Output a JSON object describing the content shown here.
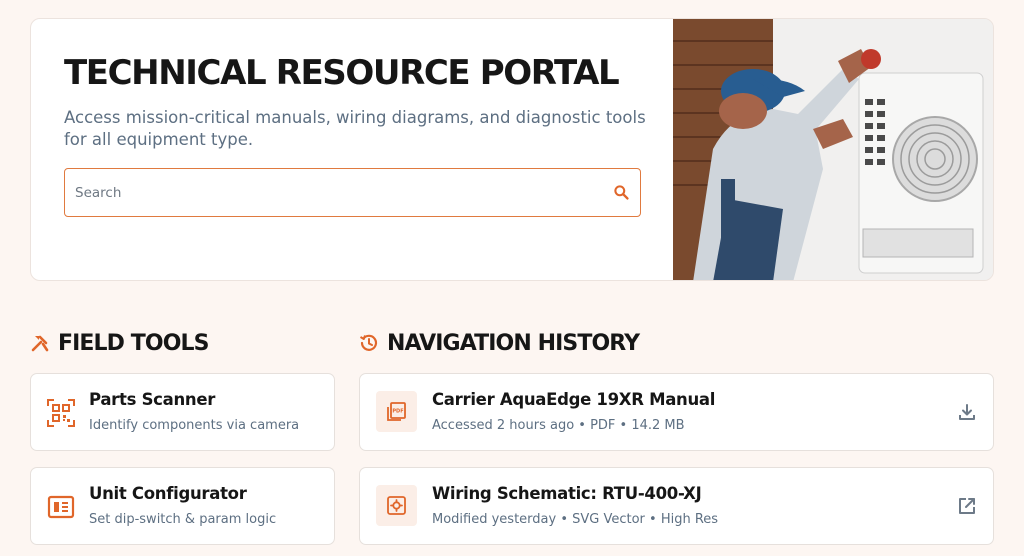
{
  "hero": {
    "title": "TECHNICAL RESOURCE PORTAL",
    "subtitle": "Access mission-critical manuals, wiring diagrams, and diagnostic tools for all equipment type.",
    "search_placeholder": "Search"
  },
  "field_tools": {
    "title": "FIELD TOOLS",
    "items": [
      {
        "title": "Parts Scanner",
        "subtitle": "Identify components via camera",
        "icon": "qr-scan-icon"
      },
      {
        "title": "Unit Configurator",
        "subtitle": "Set dip-switch & param logic",
        "icon": "chip-icon"
      }
    ]
  },
  "navigation_history": {
    "title": "NAVIGATION HISTORY",
    "items": [
      {
        "title": "Carrier AquaEdge 19XR Manual",
        "meta": "Accessed 2 hours ago • PDF • 14.2 MB",
        "icon": "pdf-file-icon",
        "action": "download-icon"
      },
      {
        "title": "Wiring Schematic: RTU-400-XJ",
        "meta": "Modified yesterday • SVG Vector • High Res",
        "icon": "gear-icon",
        "action": "external-link-icon"
      }
    ]
  },
  "colors": {
    "accent": "#e0662a",
    "muted": "#5d6f82",
    "background": "#fdf6f2"
  }
}
